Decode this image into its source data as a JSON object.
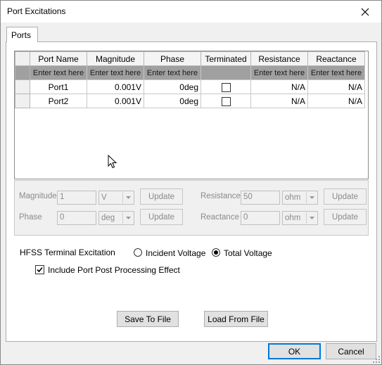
{
  "window": {
    "title": "Port Excitations"
  },
  "tabs": [
    {
      "label": "Ports"
    }
  ],
  "grid": {
    "columns": [
      "Port Name",
      "Magnitude",
      "Phase",
      "Terminated",
      "Resistance",
      "Reactance"
    ],
    "filter_placeholder": "Enter text here",
    "rows": [
      {
        "name": "Port1",
        "magnitude": "0.001V",
        "phase": "0deg",
        "terminated": false,
        "resistance": "N/A",
        "reactance": "N/A"
      },
      {
        "name": "Port2",
        "magnitude": "0.001V",
        "phase": "0deg",
        "terminated": false,
        "resistance": "N/A",
        "reactance": "N/A"
      }
    ]
  },
  "props": {
    "magnitude_label": "Magnitude",
    "magnitude_value": "1",
    "magnitude_unit": "V",
    "phase_label": "Phase",
    "phase_value": "0",
    "phase_unit": "deg",
    "resistance_label": "Resistance",
    "resistance_value": "50",
    "resistance_unit": "ohm",
    "reactance_label": "Reactance",
    "reactance_value": "0",
    "reactance_unit": "ohm",
    "update_label": "Update"
  },
  "excitation": {
    "label": "HFSS Terminal Excitation",
    "incident_label": "Incident Voltage",
    "total_label": "Total Voltage",
    "selected": "Total Voltage"
  },
  "include": {
    "label": "Include Port Post Processing Effect",
    "checked": true
  },
  "buttons": {
    "save": "Save To File",
    "load": "Load From File",
    "ok": "OK",
    "cancel": "Cancel"
  }
}
